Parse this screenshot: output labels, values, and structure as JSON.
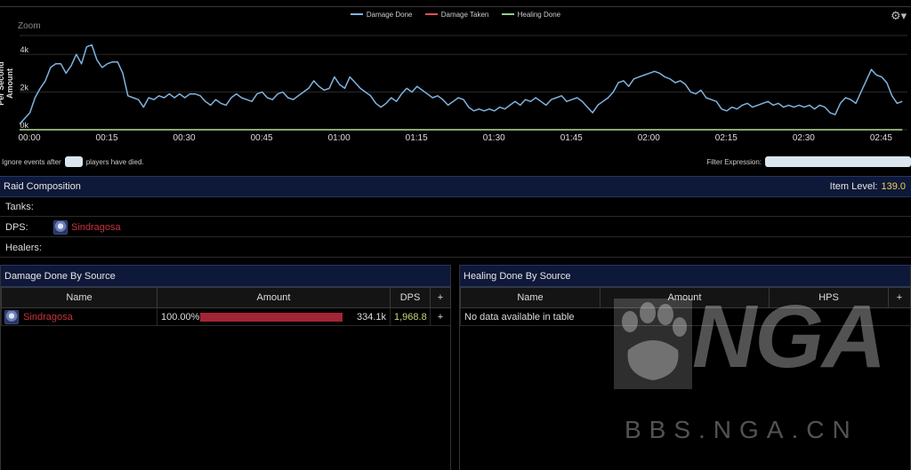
{
  "chart": {
    "zoom_label": "Zoom",
    "ylabel": "Per Second Amount",
    "legend": [
      {
        "name": "Damage Done",
        "color": "#7fb3e0"
      },
      {
        "name": "Damage Taken",
        "color": "#e05252"
      },
      {
        "name": "Healing Done",
        "color": "#8fd08f"
      }
    ],
    "settings_icon": "gear-icon"
  },
  "chart_data": {
    "type": "line",
    "title": "",
    "xlabel": "",
    "ylabel": "Per Second Amount",
    "xlim": [
      0,
      172
    ],
    "ylim": [
      0,
      5000
    ],
    "x_ticks": [
      {
        "v": 0,
        "label": "00:00"
      },
      {
        "v": 15,
        "label": "00:15"
      },
      {
        "v": 30,
        "label": "00:30"
      },
      {
        "v": 45,
        "label": "00:45"
      },
      {
        "v": 60,
        "label": "01:00"
      },
      {
        "v": 75,
        "label": "01:15"
      },
      {
        "v": 90,
        "label": "01:30"
      },
      {
        "v": 105,
        "label": "01:45"
      },
      {
        "v": 120,
        "label": "02:00"
      },
      {
        "v": 135,
        "label": "02:15"
      },
      {
        "v": 150,
        "label": "02:30"
      },
      {
        "v": 165,
        "label": "02:45"
      }
    ],
    "y_ticks": [
      {
        "v": 0,
        "label": "0k"
      },
      {
        "v": 2000,
        "label": "2k"
      },
      {
        "v": 4000,
        "label": "4k"
      }
    ],
    "grid": true,
    "series": [
      {
        "name": "Damage Done",
        "color": "#7fb3e0",
        "points": [
          [
            0,
            300
          ],
          [
            1,
            600
          ],
          [
            2,
            900
          ],
          [
            3,
            1700
          ],
          [
            4,
            2200
          ],
          [
            5,
            2600
          ],
          [
            6,
            3300
          ],
          [
            7,
            3500
          ],
          [
            8,
            3500
          ],
          [
            9,
            3000
          ],
          [
            10,
            3400
          ],
          [
            11,
            4000
          ],
          [
            12,
            3500
          ],
          [
            13,
            4400
          ],
          [
            14,
            4500
          ],
          [
            15,
            3700
          ],
          [
            16,
            3300
          ],
          [
            17,
            3500
          ],
          [
            18,
            3600
          ],
          [
            19,
            3600
          ],
          [
            20,
            3000
          ],
          [
            21,
            1800
          ],
          [
            22,
            1700
          ],
          [
            23,
            1600
          ],
          [
            24,
            1200
          ],
          [
            25,
            1700
          ],
          [
            26,
            1600
          ],
          [
            27,
            1800
          ],
          [
            28,
            1700
          ],
          [
            29,
            1900
          ],
          [
            30,
            1700
          ],
          [
            31,
            1900
          ],
          [
            32,
            1700
          ],
          [
            33,
            1900
          ],
          [
            34,
            1900
          ],
          [
            35,
            1800
          ],
          [
            36,
            1500
          ],
          [
            37,
            1300
          ],
          [
            38,
            1600
          ],
          [
            39,
            1400
          ],
          [
            40,
            1300
          ],
          [
            41,
            1700
          ],
          [
            42,
            1900
          ],
          [
            43,
            1700
          ],
          [
            44,
            1600
          ],
          [
            45,
            1500
          ],
          [
            46,
            1900
          ],
          [
            47,
            2000
          ],
          [
            48,
            1700
          ],
          [
            49,
            1600
          ],
          [
            50,
            1900
          ],
          [
            51,
            2000
          ],
          [
            52,
            1700
          ],
          [
            53,
            1600
          ],
          [
            54,
            1800
          ],
          [
            55,
            2000
          ],
          [
            56,
            2200
          ],
          [
            57,
            2600
          ],
          [
            58,
            2300
          ],
          [
            59,
            2100
          ],
          [
            60,
            2200
          ],
          [
            61,
            2800
          ],
          [
            62,
            2400
          ],
          [
            63,
            2200
          ],
          [
            64,
            2800
          ],
          [
            65,
            2500
          ],
          [
            66,
            2200
          ],
          [
            67,
            2000
          ],
          [
            68,
            1800
          ],
          [
            69,
            1400
          ],
          [
            70,
            1200
          ],
          [
            71,
            1400
          ],
          [
            72,
            1700
          ],
          [
            73,
            1500
          ],
          [
            74,
            1900
          ],
          [
            75,
            2200
          ],
          [
            76,
            2000
          ],
          [
            77,
            2300
          ],
          [
            78,
            2100
          ],
          [
            79,
            1900
          ],
          [
            80,
            1700
          ],
          [
            81,
            1800
          ],
          [
            82,
            1600
          ],
          [
            83,
            1300
          ],
          [
            84,
            1500
          ],
          [
            85,
            1700
          ],
          [
            86,
            1600
          ],
          [
            87,
            1200
          ],
          [
            88,
            1000
          ],
          [
            89,
            1100
          ],
          [
            90,
            1000
          ],
          [
            91,
            1100
          ],
          [
            92,
            1000
          ],
          [
            93,
            1200
          ],
          [
            94,
            1100
          ],
          [
            95,
            1300
          ],
          [
            96,
            1500
          ],
          [
            97,
            1300
          ],
          [
            98,
            1600
          ],
          [
            99,
            1500
          ],
          [
            100,
            1700
          ],
          [
            101,
            1500
          ],
          [
            102,
            1300
          ],
          [
            103,
            1600
          ],
          [
            104,
            1700
          ],
          [
            105,
            1800
          ],
          [
            106,
            1500
          ],
          [
            107,
            1600
          ],
          [
            108,
            1700
          ],
          [
            109,
            1500
          ],
          [
            110,
            1200
          ],
          [
            111,
            900
          ],
          [
            112,
            1300
          ],
          [
            113,
            1500
          ],
          [
            114,
            1700
          ],
          [
            115,
            2000
          ],
          [
            116,
            2500
          ],
          [
            117,
            2600
          ],
          [
            118,
            2300
          ],
          [
            119,
            2700
          ],
          [
            120,
            2800
          ],
          [
            121,
            2900
          ],
          [
            122,
            3000
          ],
          [
            123,
            3100
          ],
          [
            124,
            3000
          ],
          [
            125,
            2800
          ],
          [
            126,
            2700
          ],
          [
            127,
            2500
          ],
          [
            128,
            2600
          ],
          [
            129,
            2400
          ],
          [
            130,
            2000
          ],
          [
            131,
            1900
          ],
          [
            132,
            2100
          ],
          [
            133,
            1700
          ],
          [
            134,
            1600
          ],
          [
            135,
            1500
          ],
          [
            136,
            1100
          ],
          [
            137,
            1000
          ],
          [
            138,
            1200
          ],
          [
            139,
            1100
          ],
          [
            140,
            1300
          ],
          [
            141,
            1400
          ],
          [
            142,
            1200
          ],
          [
            143,
            1300
          ],
          [
            144,
            1400
          ],
          [
            145,
            1500
          ],
          [
            146,
            1300
          ],
          [
            147,
            1400
          ],
          [
            148,
            1200
          ],
          [
            149,
            1300
          ],
          [
            150,
            1200
          ],
          [
            151,
            1300
          ],
          [
            152,
            1200
          ],
          [
            153,
            1300
          ],
          [
            154,
            1100
          ],
          [
            155,
            1300
          ],
          [
            156,
            1200
          ],
          [
            157,
            900
          ],
          [
            158,
            800
          ],
          [
            159,
            1400
          ],
          [
            160,
            1700
          ],
          [
            161,
            1600
          ],
          [
            162,
            1400
          ],
          [
            163,
            2000
          ],
          [
            164,
            2600
          ],
          [
            165,
            3200
          ],
          [
            166,
            2900
          ],
          [
            167,
            2800
          ],
          [
            168,
            2500
          ],
          [
            169,
            1800
          ],
          [
            170,
            1400
          ],
          [
            171,
            1500
          ]
        ]
      },
      {
        "name": "Damage Taken",
        "color": "#e05252",
        "points": [
          [
            0,
            0
          ],
          [
            171,
            0
          ]
        ]
      },
      {
        "name": "Healing Done",
        "color": "#8fd08f",
        "points": [
          [
            0,
            0
          ],
          [
            171,
            0
          ]
        ]
      }
    ]
  },
  "filters": {
    "ignore_prefix": "Ignore events after",
    "ignore_suffix": "players have died.",
    "ignore_value": "",
    "filter_label": "Filter Expression:",
    "filter_value": ""
  },
  "raid": {
    "title": "Raid Composition",
    "item_level_label": "Item Level:",
    "item_level_value": "139.0",
    "tanks_label": "Tanks:",
    "dps_label": "DPS:",
    "dps_player": "Sindragosa",
    "healers_label": "Healers:"
  },
  "damage_table": {
    "title": "Damage Done By Source",
    "columns": [
      "Name",
      "Amount",
      "DPS",
      "+"
    ],
    "rows": [
      {
        "name": "Sindragosa",
        "pct": "100.00%",
        "pct_value": 100,
        "amount": "334.1k",
        "dps": "1,968.8",
        "plus": "+"
      }
    ]
  },
  "healing_table": {
    "title": "Healing Done By Source",
    "columns": [
      "Name",
      "Amount",
      "HPS",
      "+"
    ],
    "empty_text": "No data available in table"
  },
  "watermark": {
    "logo_text": "NGA",
    "url_text": "BBS.NGA.CN"
  },
  "colors": {
    "header_bg": "#0e1838",
    "player_name": "#c8333f",
    "bar": "#a32435",
    "dps_value": "#c6d67a",
    "item_level": "#f0d060"
  }
}
